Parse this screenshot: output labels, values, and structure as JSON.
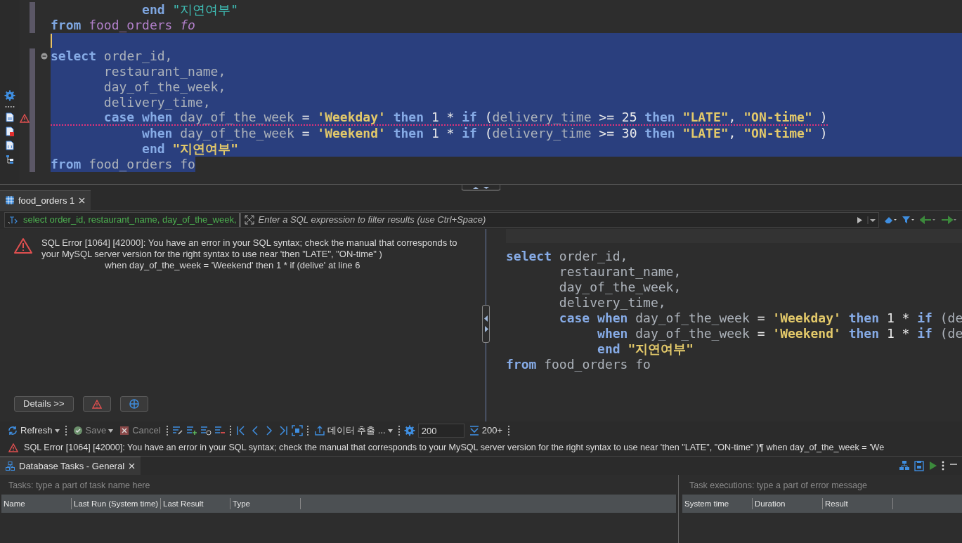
{
  "editor": {
    "lines": [
      {
        "selected": false,
        "caret": false,
        "error": false,
        "foldable": false,
        "warning": false,
        "tokens": [
          {
            "text": "            end ",
            "kind": "kw"
          },
          {
            "text": "\"지연여부\"",
            "kind": "quoted"
          }
        ]
      },
      {
        "selected": false,
        "caret": false,
        "error": false,
        "foldable": false,
        "warning": false,
        "tokens": [
          {
            "text": "from ",
            "kind": "kw"
          },
          {
            "text": "food_orders ",
            "kind": "table"
          },
          {
            "text": "fo",
            "kind": "alias"
          }
        ]
      },
      {
        "selected": true,
        "caret": true,
        "error": false,
        "foldable": false,
        "warning": false
      },
      {
        "selected": true,
        "caret": false,
        "error": false,
        "foldable": true,
        "warning": false,
        "tokens": [
          {
            "text": "select",
            "kind": "kw"
          },
          {
            "text": " order_id,",
            "kind": "ident"
          }
        ]
      },
      {
        "selected": true,
        "caret": false,
        "error": false,
        "foldable": false,
        "warning": false,
        "tokens": [
          {
            "text": "       restaurant_name,",
            "kind": "ident"
          }
        ]
      },
      {
        "selected": true,
        "caret": false,
        "error": false,
        "foldable": false,
        "warning": false,
        "tokens": [
          {
            "text": "       day_of_the_week,",
            "kind": "ident"
          }
        ]
      },
      {
        "selected": true,
        "caret": false,
        "error": false,
        "foldable": false,
        "warning": false,
        "tokens": [
          {
            "text": "       delivery_time,",
            "kind": "ident"
          }
        ]
      },
      {
        "selected": true,
        "caret": false,
        "error": true,
        "foldable": false,
        "warning": true,
        "tokens": [
          {
            "text": "       case when ",
            "kind": "kw"
          },
          {
            "text": "day_of_the_week ",
            "kind": "ident"
          },
          {
            "text": "= ",
            "kind": "op"
          },
          {
            "text": "'Weekday' ",
            "kind": "str"
          },
          {
            "text": "then ",
            "kind": "kw"
          },
          {
            "text": "1 * ",
            "kind": "op"
          },
          {
            "text": "if",
            "kind": "kw"
          },
          {
            "text": " (",
            "kind": "op"
          },
          {
            "text": "delivery_time",
            "kind": "ident"
          },
          {
            "text": " >= 25 ",
            "kind": "op"
          },
          {
            "text": "then ",
            "kind": "kw"
          },
          {
            "text": "\"LATE\"",
            "kind": "str"
          },
          {
            "text": ", ",
            "kind": "op"
          },
          {
            "text": "\"ON-time\"",
            "kind": "str"
          },
          {
            "text": " )",
            "kind": "op"
          }
        ]
      },
      {
        "selected": true,
        "caret": false,
        "error": false,
        "foldable": false,
        "warning": false,
        "tokens": [
          {
            "text": "            when ",
            "kind": "kw"
          },
          {
            "text": "day_of_the_week ",
            "kind": "ident"
          },
          {
            "text": "= ",
            "kind": "op"
          },
          {
            "text": "'Weekend' ",
            "kind": "str"
          },
          {
            "text": "then ",
            "kind": "kw"
          },
          {
            "text": "1 * ",
            "kind": "op"
          },
          {
            "text": "if",
            "kind": "kw"
          },
          {
            "text": " (",
            "kind": "op"
          },
          {
            "text": "delivery_time",
            "kind": "ident"
          },
          {
            "text": " >= 30 ",
            "kind": "op"
          },
          {
            "text": "then ",
            "kind": "kw"
          },
          {
            "text": "\"LATE\"",
            "kind": "str"
          },
          {
            "text": ", ",
            "kind": "op"
          },
          {
            "text": "\"ON-time\"",
            "kind": "str"
          },
          {
            "text": " )",
            "kind": "op"
          }
        ]
      },
      {
        "selected": true,
        "caret": false,
        "error": false,
        "foldable": false,
        "warning": false,
        "tokens": [
          {
            "text": "            end ",
            "kind": "kw"
          },
          {
            "text": "\"지연여부\"",
            "kind": "quoted"
          }
        ]
      },
      {
        "selected": true,
        "caret": false,
        "error": false,
        "foldable": false,
        "warning": false,
        "tokens": [
          {
            "text": "from ",
            "kind": "kw"
          },
          {
            "text": "food_orders ",
            "kind": "table"
          },
          {
            "text": "fo",
            "kind": "alias"
          }
        ]
      }
    ]
  },
  "results": {
    "tab": {
      "label": "food_orders 1",
      "selected": true
    },
    "filter": {
      "query": "select order_id, restaurant_name, day_of_the_week,",
      "placeholder": "Enter a SQL expression to filter results (use Ctrl+Space)"
    },
    "error": {
      "message": "SQL Error [1064] [42000]: You have an error in your SQL syntax; check the manual that corresponds to your MySQL server version for the right syntax to use near 'then \"LATE\", \"ON-time\" )\n                         when day_of_the_week = 'Weekend' then 1 * if (delive' at line 6",
      "details_button": "Details >>"
    },
    "preview": {
      "lines": [
        {
          "tokens": [
            {
              "text": "select",
              "kind": "kw"
            },
            {
              "text": " order_id,",
              "kind": "ident"
            }
          ]
        },
        {
          "tokens": [
            {
              "text": "       restaurant_name,",
              "kind": "ident"
            }
          ]
        },
        {
          "tokens": [
            {
              "text": "       day_of_the_week,",
              "kind": "ident"
            }
          ]
        },
        {
          "tokens": [
            {
              "text": "       delivery_time,",
              "kind": "ident"
            }
          ]
        },
        {
          "tokens": [
            {
              "text": "       case when ",
              "kind": "kw"
            },
            {
              "text": "day_of_the_week ",
              "kind": "ident"
            },
            {
              "text": "= ",
              "kind": "op"
            },
            {
              "text": "'Weekday' ",
              "kind": "str"
            },
            {
              "text": "then ",
              "kind": "kw"
            },
            {
              "text": "1 * ",
              "kind": "op"
            },
            {
              "text": "if",
              "kind": "kw"
            },
            {
              "text": " (de",
              "kind": "ident"
            }
          ]
        },
        {
          "tokens": [
            {
              "text": "            when ",
              "kind": "kw"
            },
            {
              "text": "day_of_the_week ",
              "kind": "ident"
            },
            {
              "text": "= ",
              "kind": "op"
            },
            {
              "text": "'Weekend' ",
              "kind": "str"
            },
            {
              "text": "then ",
              "kind": "kw"
            },
            {
              "text": "1 * ",
              "kind": "op"
            },
            {
              "text": "if",
              "kind": "kw"
            },
            {
              "text": " (de",
              "kind": "ident"
            }
          ]
        },
        {
          "tokens": [
            {
              "text": "            end ",
              "kind": "kw"
            },
            {
              "text": "\"지연여부\"",
              "kind": "str"
            }
          ]
        },
        {
          "tokens": [
            {
              "text": "from",
              "kind": "kw"
            },
            {
              "text": " food_orders fo",
              "kind": "ident"
            }
          ]
        }
      ]
    }
  },
  "toolbar": {
    "items": [
      {
        "kind": "refresh",
        "label": "Refresh",
        "disabled": false
      },
      {
        "kind": "save",
        "label": "Save",
        "disabled": true
      },
      {
        "kind": "cancel",
        "label": "Cancel",
        "disabled": true
      },
      {
        "kind": "export",
        "label": "데이터 추출 ...",
        "disabled": false
      },
      {
        "kind": "field",
        "value": "200"
      },
      {
        "kind": "fetch",
        "label": "200+",
        "disabled": false
      }
    ]
  },
  "status_bar": {
    "message": "SQL Error [1064] [42000]: You have an error in your SQL syntax; check the manual that corresponds to your MySQL server version for the right syntax to use near 'then \"LATE\", \"ON-time\" )¶   when day_of_the_week = 'We"
  },
  "tasks": {
    "tab": {
      "label": "Database Tasks - General",
      "selected": true
    },
    "placeholder": "Tasks: type a part of task name here",
    "columns": [
      "Name",
      "Last Run (System time)",
      "Last Result",
      "Type"
    ],
    "executions": {
      "placeholder": "Task executions: type a part of error message",
      "columns": [
        "System time",
        "Duration",
        "Result"
      ]
    }
  }
}
